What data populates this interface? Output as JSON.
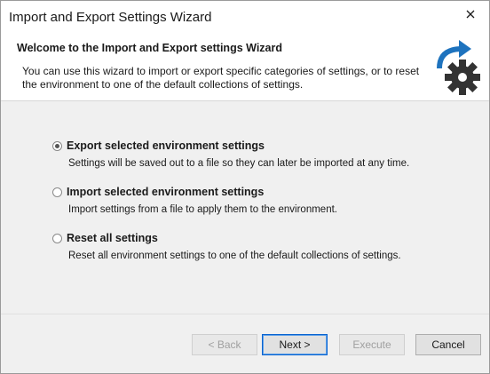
{
  "window": {
    "title": "Import and Export Settings Wizard"
  },
  "header": {
    "title": "Welcome to the Import and Export settings Wizard",
    "description": "You can use this wizard to import or export specific categories of settings, or to reset the environment to one of the default collections of settings."
  },
  "options": [
    {
      "label": "Export selected environment settings",
      "description": "Settings will be saved out to a file so they can later be imported at any time.",
      "selected": true
    },
    {
      "label": "Import selected environment settings",
      "description": "Import settings from a file to apply them to the environment.",
      "selected": false
    },
    {
      "label": "Reset all settings",
      "description": "Reset all environment settings to one of the default collections of settings.",
      "selected": false
    }
  ],
  "buttons": {
    "back": "< Back",
    "next": "Next >",
    "execute": "Execute",
    "cancel": "Cancel"
  },
  "colors": {
    "icon_blue": "#1e73be",
    "icon_gear": "#333333"
  }
}
